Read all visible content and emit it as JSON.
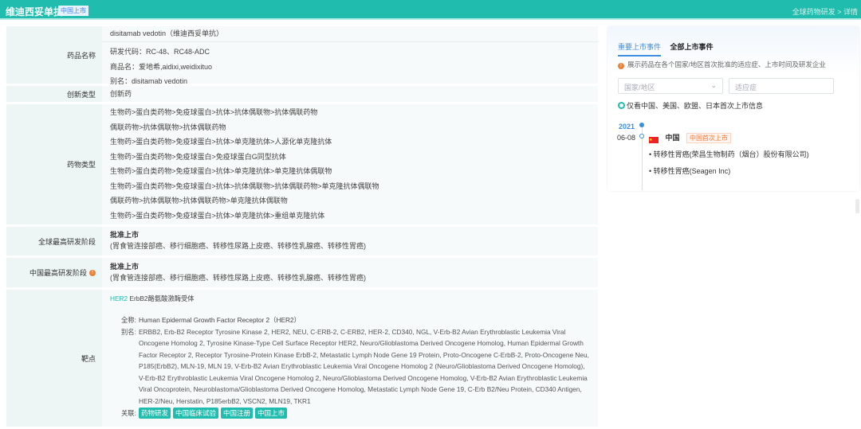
{
  "header": {
    "title": "维迪西妥单抗",
    "badge": "中国上市",
    "breadcrumb": "全球药物研发 > 详情"
  },
  "rows": {
    "name": {
      "label": "药品名称",
      "primary": "disitamab vedotin（维迪西妥单抗）",
      "code": "研发代码：RC-48、RC48-ADC",
      "trade": "商品名：爱地希,aidixi,weidixituo",
      "alias": "别名：disitamab vedotin"
    },
    "innovation": {
      "label": "创新类型",
      "value": "创新药"
    },
    "drug_type": {
      "label": "药物类型",
      "items": [
        "生物药>蛋白类药物>免疫球蛋白>抗体>抗体偶联物>抗体偶联药物",
        "偶联药物>抗体偶联物>抗体偶联药物",
        "生物药>蛋白类药物>免疫球蛋白>抗体>单克隆抗体>人源化单克隆抗体",
        "生物药>蛋白类药物>免疫球蛋白>免疫球蛋白G同型抗体",
        "生物药>蛋白类药物>免疫球蛋白>抗体>单克隆抗体>单克隆抗体偶联物",
        "生物药>蛋白类药物>免疫球蛋白>抗体>抗体偶联物>抗体偶联药物>单克隆抗体偶联物",
        "偶联药物>抗体偶联物>抗体偶联药物>单克隆抗体偶联物",
        "生物药>蛋白类药物>免疫球蛋白>抗体>单克隆抗体>重组单克隆抗体"
      ]
    },
    "global_phase": {
      "label": "全球最高研发阶段",
      "stage": "批准上市",
      "indications": "(胃食管连接部癌、移行细胞癌、转移性尿路上皮癌、转移性乳腺癌、转移性胃癌)"
    },
    "china_phase": {
      "label": "中国最高研发阶段",
      "stage": "批准上市",
      "indications": "(胃食管连接部癌、移行细胞癌、转移性尿路上皮癌、转移性乳腺癌、转移性胃癌)"
    },
    "target": {
      "label": "靶点",
      "code": "HER2",
      "name": "ErbB2酪氨酸激酶受体",
      "full_label": "全称:",
      "full": "Human Epidermal Growth Factor Receptor 2（HER2）",
      "alias_label": "别名:",
      "alias": "ERBB2, Erb-B2 Receptor Tyrosine Kinase 2, HER2, NEU, C-ERB-2, C-ERB2, HER-2, CD340, NGL, V-Erb-B2 Avian Erythroblastic Leukemia Viral Oncogene Homolog 2, Tyrosine Kinase-Type Cell Surface Receptor HER2, Neuro/Glioblastoma Derived Oncogene Homolog, Human Epidermal Growth Factor Receptor 2, Receptor Tyrosine-Protein Kinase ErbB-2, Metastatic Lymph Node Gene 19 Protein, Proto-Oncogene C-ErbB-2, Proto-Oncogene Neu, P185(ErbB2), MLN-19, MLN 19, V-Erb-B2 Avian Erythroblastic Leukemia Viral Oncogene Homolog 2 (Neuro/Glioblastoma Derived Oncogene Homolog), V-Erb-B2 Erythroblastic Leukemia Viral Oncogene Homolog 2, Neuro/Glioblastoma Derived Oncogene Homolog, V-Erb-B2 Avian Erythroblastic Leukemia Viral Oncoprotein, Neuroblastoma/Glioblastoma Derived Oncogene Homolog, Metastatic Lymph Node Gene 19, C-Erb B2/Neu Protein, CD340 Antigen, HER-2/Neu, Herstatin, P185erbB2, VSCN2, MLN19, TKR1",
      "related_label": "关联:",
      "tags": [
        "药物研发",
        "中国临床试验",
        "中国注册",
        "中国上市"
      ]
    }
  },
  "events": {
    "tabs": [
      "重要上市事件",
      "全部上市事件"
    ],
    "hint": "展示药品在各个国家/地区首次批准的适应症、上市时间及研发企业",
    "country_placeholder": "国家/地区",
    "indication_placeholder": "适应症",
    "radio": "仅看中国、美国、欧盟、日本首次上市信息",
    "year": "2021",
    "date": "06-08",
    "country": "中国",
    "country_tag": "中国首次上市",
    "items": [
      "转移性胃癌(荣昌生物制药（烟台）股份有限公司)",
      "转移性胃癌(Seagen Inc)"
    ]
  }
}
